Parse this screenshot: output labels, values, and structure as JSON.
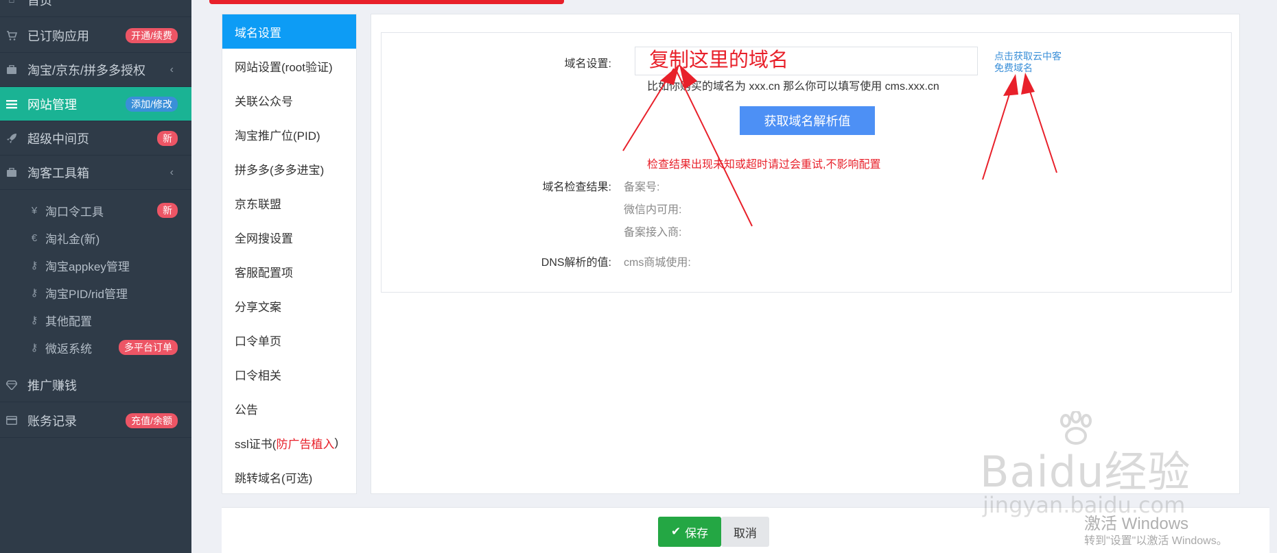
{
  "sidebar": {
    "items": [
      {
        "label": "首页",
        "icon": "home-icon"
      },
      {
        "label": "已订购应用",
        "badge": "开通/续费",
        "icon": "cart-icon"
      },
      {
        "label": "淘宝/京东/拼多多授权",
        "icon": "briefcase-icon"
      },
      {
        "label": "网站管理",
        "badge": "添加/修改",
        "icon": "menu-icon"
      },
      {
        "label": "超级中间页",
        "badge": "新",
        "icon": "rocket-icon"
      },
      {
        "label": "淘客工具箱",
        "icon": "toolbox-icon"
      },
      {
        "label": "推广赚钱",
        "icon": "diamond-icon"
      },
      {
        "label": "账务记录",
        "badge": "充值/余额",
        "icon": "card-icon"
      }
    ],
    "sub_items": [
      {
        "label": "淘口令工具",
        "badge": "新",
        "icon": "yen-icon"
      },
      {
        "label": "淘礼金(新)",
        "icon": "euro-icon"
      },
      {
        "label": "淘宝appkey管理",
        "icon": "key-icon"
      },
      {
        "label": "淘宝PID/rid管理",
        "icon": "key-icon"
      },
      {
        "label": "其他配置",
        "icon": "key-icon"
      },
      {
        "label": "微返系统",
        "badge": "多平台订单",
        "icon": "key-icon"
      }
    ]
  },
  "menu": {
    "items": [
      {
        "label": "域名设置"
      },
      {
        "label": "网站设置(root验证)"
      },
      {
        "label": "关联公众号"
      },
      {
        "label": "淘宝推广位(PID)"
      },
      {
        "label": "拼多多(多多进宝)"
      },
      {
        "label": "京东联盟"
      },
      {
        "label": "全网搜设置"
      },
      {
        "label": "客服配置项"
      },
      {
        "label": "分享文案"
      },
      {
        "label": "口令单页"
      },
      {
        "label": "口令相关"
      },
      {
        "label": "公告"
      },
      {
        "label": "ssl证书(",
        "red": "防广告植入",
        "suffix": ")"
      },
      {
        "label": "跳转域名(可选)"
      }
    ]
  },
  "form": {
    "domain_label": "域名设置:",
    "domain_value": "",
    "copy_annotation": "复制这里的域名",
    "domain_hint": "比如你购买的域名为 xxx.cn 那么你可以填写使用 cms.xxx.cn",
    "free_link": "点击获取云中客免费域名",
    "get_dns_button": "获取域名解析值",
    "check_note": "检查结果出现未知或超时请过会重试,不影响配置",
    "check_result_label": "域名检查结果:",
    "record_no": "备案号:",
    "wechat_usable": "微信内可用:",
    "record_provider": "备案接入商:",
    "dns_label": "DNS解析的值:",
    "dns_value": "cms商城使用:"
  },
  "footer": {
    "save": "保存",
    "cancel": "取消"
  },
  "watermark": {
    "main": "Baidu经验",
    "sub": "jingyan.baidu.com"
  },
  "windows_activation": {
    "title": "激活 Windows",
    "hint": "转到\"设置\"以激活 Windows。"
  },
  "colors": {
    "sidebar_bg": "#2f3b48",
    "sidebar_active": "#1ab394",
    "menu_active": "#0d9cf5",
    "annotation_red": "#e8202a",
    "save_green": "#24a744"
  }
}
